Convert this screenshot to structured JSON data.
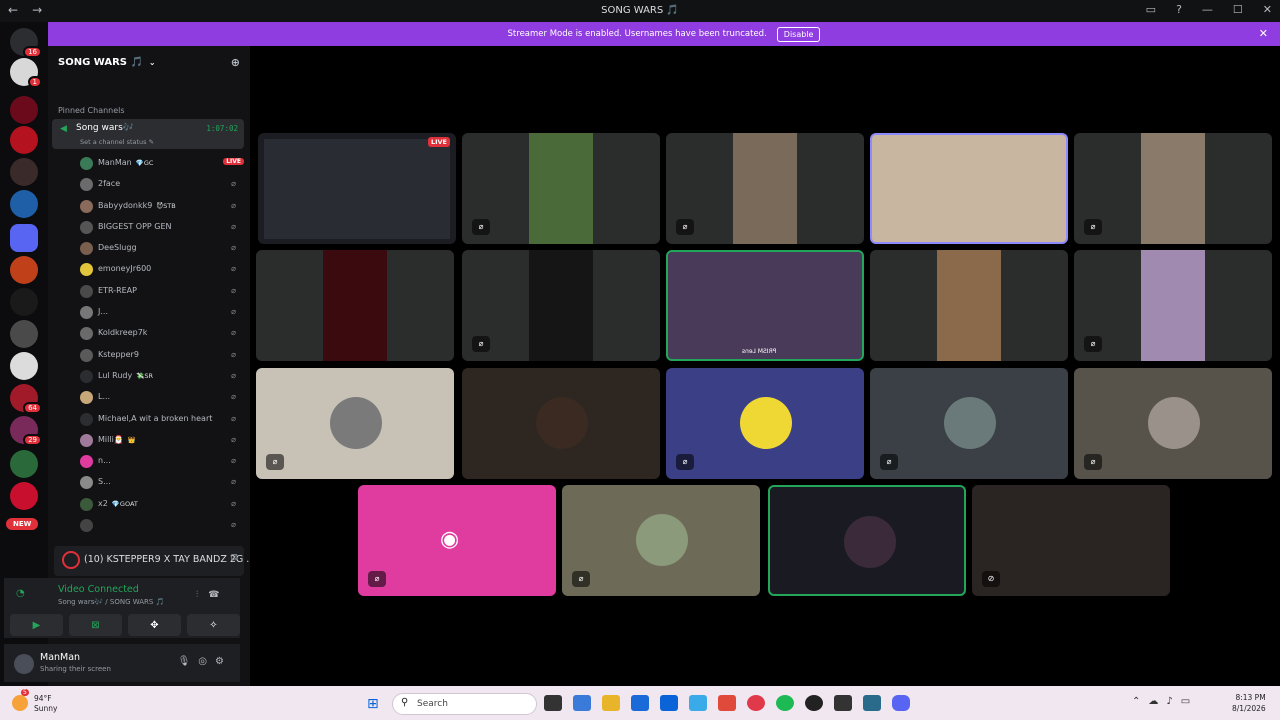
{
  "window": {
    "title": "SONG WARS 🎵",
    "back": "←",
    "forward": "→"
  },
  "guild_badges": {
    "dm": "16",
    "g1": "1",
    "g2": "64",
    "g3": "29",
    "new": "NEW"
  },
  "server": {
    "name": "SONG WARS 🎵",
    "pinned_label": "Pinned Channels"
  },
  "voice_channel": {
    "name": "Song wars🎶",
    "status": "Set a channel status ✎",
    "timer": "1:07:02"
  },
  "members": [
    {
      "name": "ManMan",
      "tag": "💎GC",
      "live": "LIVE",
      "color": "#3b7a57"
    },
    {
      "name": "2face",
      "tag": "",
      "color": "#6b6b6b"
    },
    {
      "name": "Babyydonkk9",
      "tag": "😈STB",
      "color": "#8a6a5a"
    },
    {
      "name": "BIGGEST OPP GEN",
      "tag": "",
      "color": "#555"
    },
    {
      "name": "DeeSlugg",
      "tag": "",
      "color": "#7a5f4f"
    },
    {
      "name": "emoneyJr600",
      "tag": "",
      "color": "#e1c53a"
    },
    {
      "name": "ETR-REAP",
      "tag": "",
      "color": "#4a4a4a"
    },
    {
      "name": "J...",
      "tag": "",
      "color": "#777"
    },
    {
      "name": "Koldkreep7k",
      "tag": "",
      "color": "#6a6a6a"
    },
    {
      "name": "Kstepper9",
      "tag": "",
      "color": "#5a5a5a"
    },
    {
      "name": "Lul Rudy",
      "tag": "💸SR",
      "color": "#2b2d31"
    },
    {
      "name": "L...",
      "tag": "",
      "color": "#c8a878"
    },
    {
      "name": "Michael,A wit a broken heart",
      "tag": "",
      "color": "#2b2d31"
    },
    {
      "name": "Milli🎅",
      "tag": "👑",
      "color": "#a07a9a"
    },
    {
      "name": "n...",
      "tag": "",
      "color": "#e03ca0"
    },
    {
      "name": "S...",
      "tag": "",
      "color": "#8a8a8a"
    },
    {
      "name": "x2",
      "tag": "💎GOAT",
      "color": "#3b5a3b"
    },
    {
      "name": "",
      "tag": "",
      "color": "#444"
    }
  ],
  "stream": {
    "label": "(10) KSTEPPER9 X TAY BANDZ 2G ..."
  },
  "voice_status": {
    "title": "Video Connected",
    "sub": "Song wars🎶 / SONG WARS 🎵"
  },
  "user": {
    "name": "ManMan",
    "status": "Sharing their screen"
  },
  "banner": {
    "text": "Streamer Mode is enabled. Usernames have been truncated.",
    "button": "Disable"
  },
  "tiles": {
    "live": "LIVE",
    "prism": "PRISM Lens"
  },
  "taskbar": {
    "weather_temp": "94°F",
    "weather_desc": "Sunny",
    "weather_badge": "5",
    "search": "Search",
    "time": "8:13 PM",
    "date": "8/1/2026"
  }
}
